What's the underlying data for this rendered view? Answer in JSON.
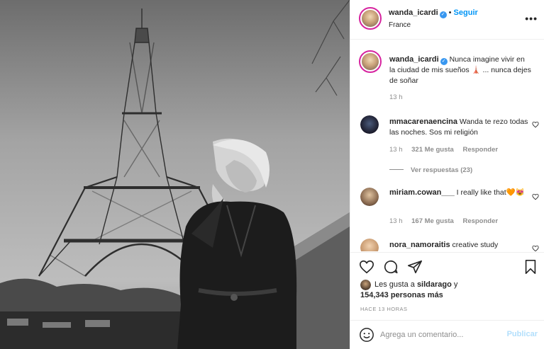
{
  "post": {
    "username": "wanda_icardi",
    "location": "France",
    "follow_label": "Seguir",
    "more_label": "•••",
    "verified_mark": "✓"
  },
  "caption": {
    "username": "wanda_icardi",
    "text": "Nunca imagine vivir en la ciudad de mis sueños 🗼 ... nunca dejes de soñar",
    "time": "13 h"
  },
  "comments": [
    {
      "username": "mmacarenaencina",
      "text": "Wanda te rezo todas las noches. Sos mi religión",
      "time": "13 h",
      "likes": "321 Me gusta",
      "reply": "Responder",
      "view_replies": "Ver respuestas (23)"
    },
    {
      "username": "miriam.cowan___",
      "text": "I really like that🧡😻",
      "time": "13 h",
      "likes": "167 Me gusta",
      "reply": "Responder"
    },
    {
      "username": "nora_namoraitis",
      "text": "creative study"
    }
  ],
  "likes": {
    "prefix": "Les gusta a",
    "user": "sildarago",
    "conj": "y",
    "count": "154,343 personas más"
  },
  "timestamp": "HACE 13 HORAS",
  "add_comment": {
    "placeholder": "Agrega un comentario...",
    "publish_label": "Publicar"
  },
  "icons": [
    "heart-icon",
    "comment-icon",
    "share-icon",
    "bookmark-icon",
    "emoji-icon",
    "more-options-icon"
  ]
}
